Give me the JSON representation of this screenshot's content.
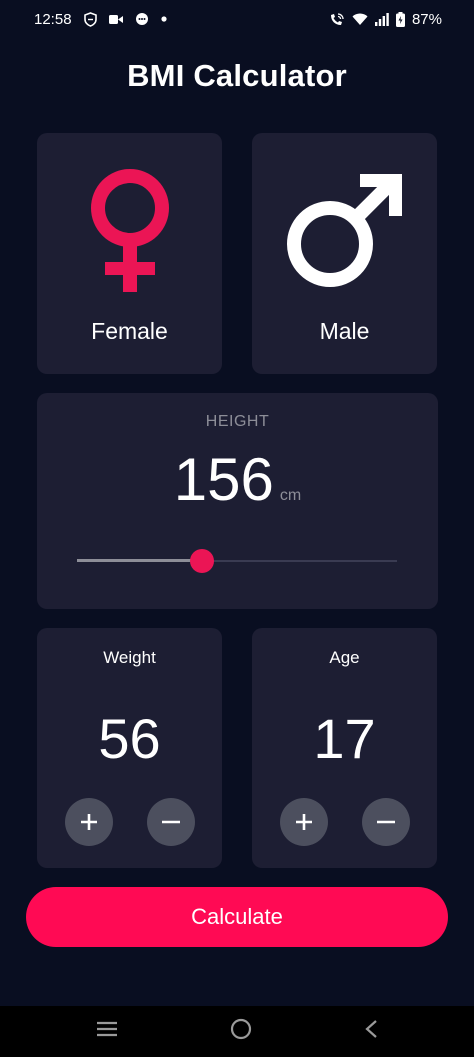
{
  "status_bar": {
    "time": "12:58",
    "battery": "87%",
    "icons_left": [
      "shield-icon",
      "video-icon",
      "chat-icon",
      "dot-icon"
    ],
    "icons_right": [
      "wifi-call-icon",
      "wifi-icon",
      "signal-icon",
      "battery-icon"
    ]
  },
  "app": {
    "title": "BMI Calculator"
  },
  "gender": {
    "female": {
      "label": "Female",
      "icon": "female-icon",
      "color": "#eb1555"
    },
    "male": {
      "label": "Male",
      "icon": "male-icon",
      "color": "#ffffff"
    }
  },
  "height": {
    "label": "HEIGHT",
    "value": "156",
    "unit": "cm",
    "slider_fraction": 0.39
  },
  "weight": {
    "label": "Weight",
    "value": "56"
  },
  "age": {
    "label": "Age",
    "value": "17"
  },
  "actions": {
    "calculate_label": "Calculate"
  },
  "colors": {
    "background": "#090e21",
    "card": "#1d1e33",
    "accent": "#eb1555",
    "button": "#ff0a54"
  },
  "nav": {
    "icons": [
      "recents-icon",
      "home-icon",
      "back-icon"
    ]
  }
}
